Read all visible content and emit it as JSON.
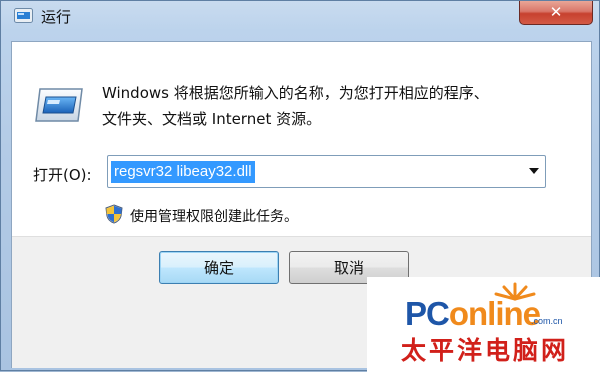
{
  "window": {
    "title": "运行",
    "close_glyph": "✕"
  },
  "dialog": {
    "description_line1": "Windows 将根据您所输入的名称，为您打开相应的程序、",
    "description_line2": "文件夹、文档或 Internet 资源。",
    "open_label": "打开(O):",
    "open_value": "regsvr32 libeay32.dll",
    "admin_note": "使用管理权限创建此任务。"
  },
  "buttons": {
    "ok_label": "确定",
    "cancel_label": "取消"
  },
  "watermark": {
    "brand_blue": "PC",
    "brand_orange": "online",
    "domain_suffix": ".com.cn",
    "chinese_name": "太平洋电脑网"
  },
  "colors": {
    "selection": "#3399ff",
    "close_button": "#c7412f",
    "brand_blue": "#1e56a8",
    "brand_orange": "#f08a1c",
    "brand_red": "#d1201a"
  },
  "icons": {
    "title": "run-icon",
    "main": "run-program-icon",
    "admin": "uac-shield-icon",
    "dropdown": "chevron-down-icon",
    "close": "close-icon"
  }
}
